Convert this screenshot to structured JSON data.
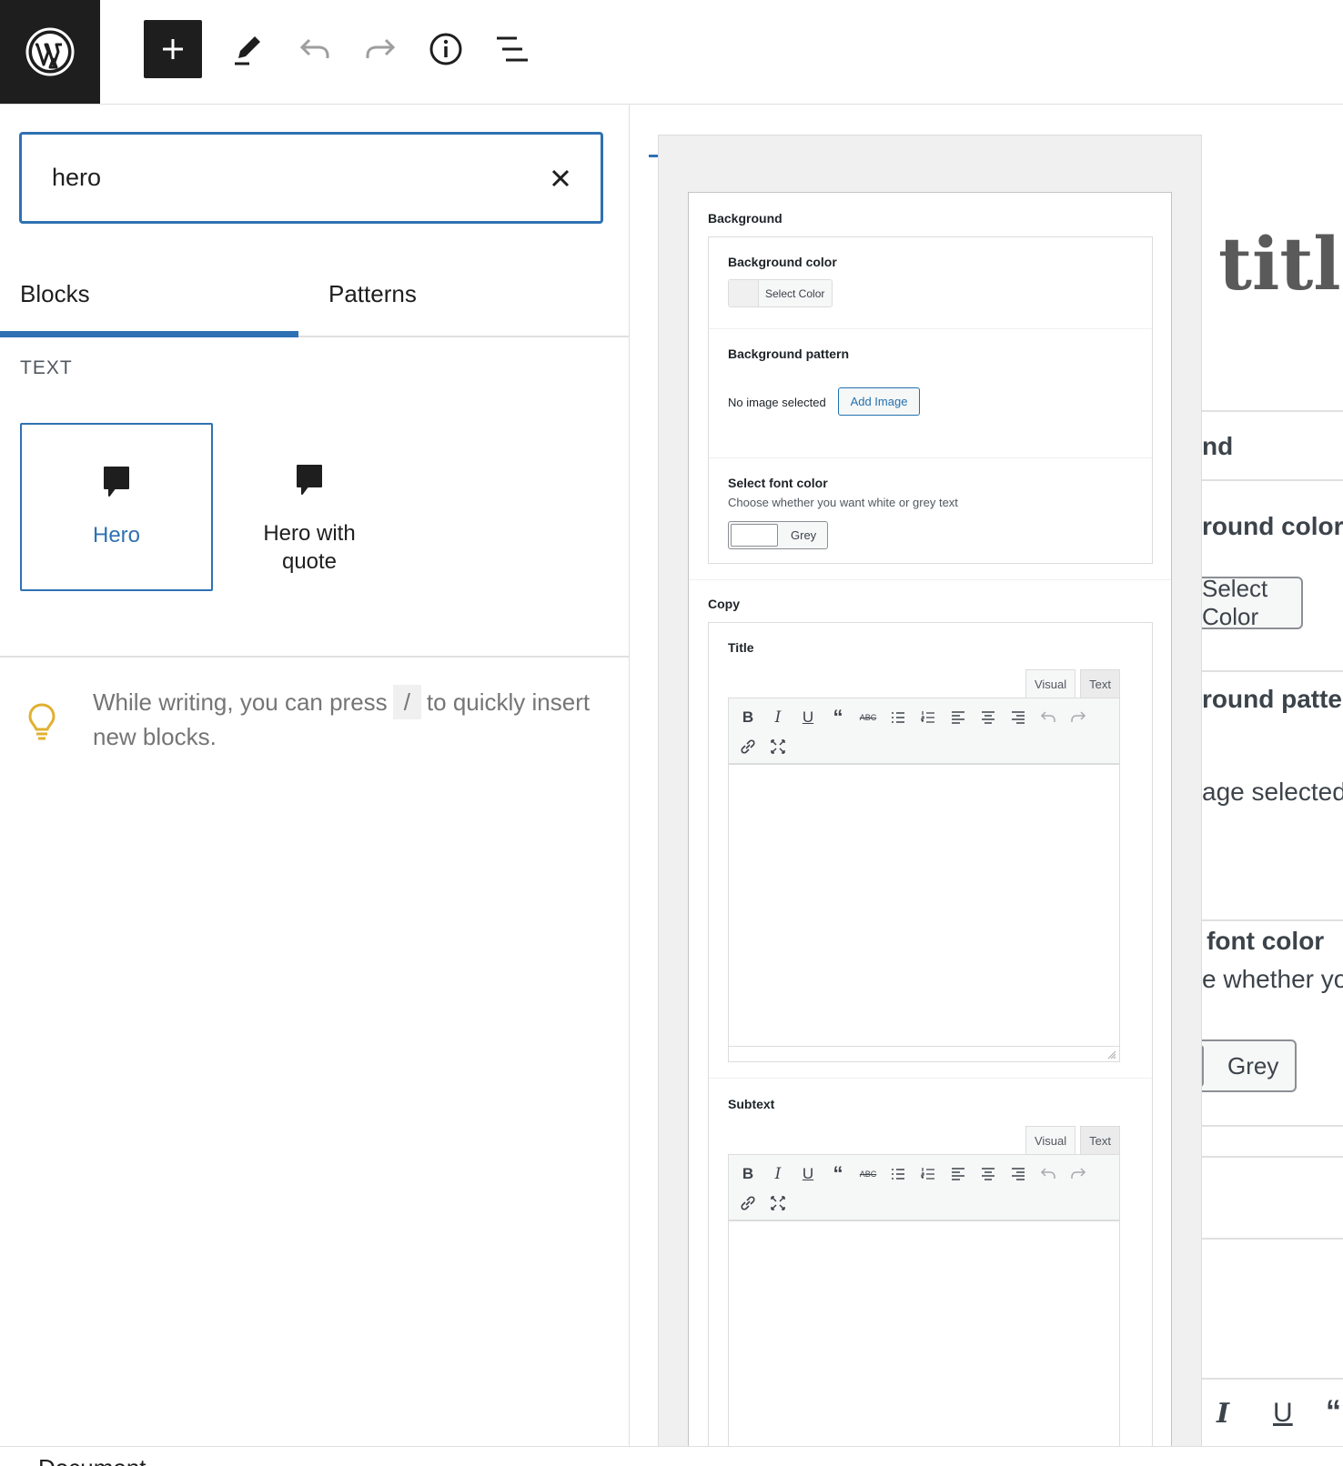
{
  "toolbar": {
    "logo_icon": "wordpress-logo",
    "buttons": [
      {
        "name": "add-block-button",
        "icon": "plus-icon"
      },
      {
        "name": "edit-tools-button",
        "icon": "pencil-icon"
      },
      {
        "name": "undo-button",
        "icon": "undo-icon"
      },
      {
        "name": "redo-button",
        "icon": "redo-icon"
      },
      {
        "name": "details-button",
        "icon": "info-icon"
      },
      {
        "name": "list-view-button",
        "icon": "list-view-icon"
      }
    ]
  },
  "inserter": {
    "search_value": "hero",
    "tabs": [
      {
        "label": "Blocks",
        "active": true
      },
      {
        "label": "Patterns",
        "active": false
      }
    ],
    "category": "TEXT",
    "blocks": [
      {
        "label": "Hero",
        "icon": "speech-bubble-icon",
        "selected": true
      },
      {
        "label": "Hero with\nquote",
        "icon": "speech-bubble-icon",
        "selected": false
      }
    ],
    "tip": {
      "before": "While writing, you can press",
      "key": "/",
      "after": "to quickly insert new blocks."
    }
  },
  "bottom": {
    "label": "Document"
  },
  "preview": {
    "sections": {
      "background": {
        "label": "Background",
        "bg_color_label": "Background color",
        "select_color": "Select Color",
        "bg_pattern_label": "Background pattern",
        "no_image": "No image selected",
        "add_image": "Add Image",
        "font_color_label": "Select font color",
        "font_color_desc": "Choose whether you want white or grey text",
        "font_color_value": "Grey"
      },
      "copy": {
        "label": "Copy",
        "title_label": "Title",
        "subtext_label": "Subtext",
        "visual_tab": "Visual",
        "text_tab": "Text"
      }
    }
  },
  "background_editor": {
    "title_fragment": "title",
    "fragments": [
      "nd",
      "round color",
      "Select Color",
      "round patter",
      "age selected",
      ": font color",
      "e whether yo",
      "Grey"
    ]
  },
  "colors": {
    "accent": "#2f71b2",
    "toolbar_dark": "#1e1e1e",
    "tip_bulb": "#e0b030"
  }
}
